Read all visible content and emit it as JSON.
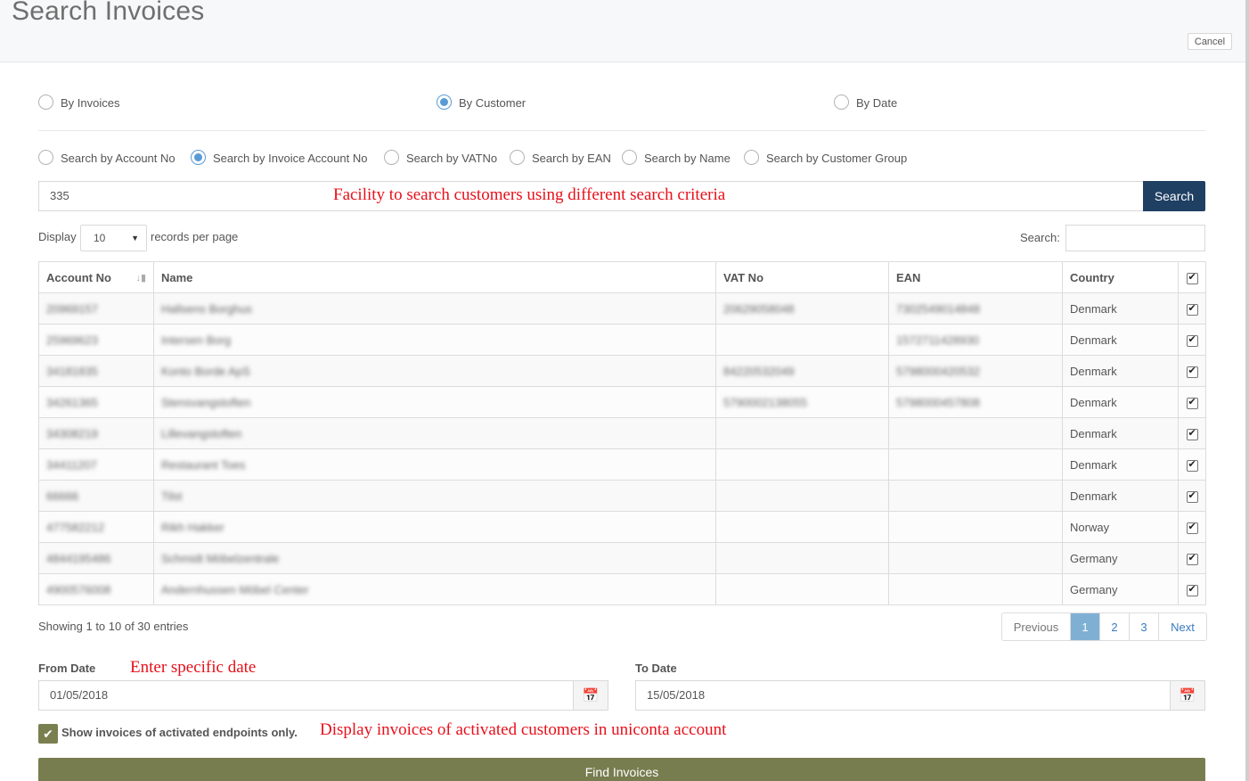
{
  "header": {
    "title": "Search Invoices",
    "cancel_label": "Cancel"
  },
  "mode_options": [
    {
      "label": "By Invoices",
      "checked": false
    },
    {
      "label": "By Customer",
      "checked": true
    },
    {
      "label": "By Date",
      "checked": false
    }
  ],
  "search_by_options": [
    {
      "label": "Search by Account No",
      "checked": false
    },
    {
      "label": "Search by Invoice Account No",
      "checked": true
    },
    {
      "label": "Search by VATNo",
      "checked": false
    },
    {
      "label": "Search by EAN",
      "checked": false
    },
    {
      "label": "Search by Name",
      "checked": false
    },
    {
      "label": "Search by Customer Group",
      "checked": false
    }
  ],
  "search": {
    "value": "335",
    "button_label": "Search"
  },
  "annotations": {
    "search_note": "Facility to search customers using different search criteria",
    "date_note": "Enter specific date",
    "activated_note": "Display invoices of activated customers in uniconta account"
  },
  "paging_controls": {
    "display_label": "Display",
    "page_size": "10",
    "records_label": "records per page",
    "filter_label": "Search:"
  },
  "table": {
    "columns": [
      "Account No",
      "Name",
      "VAT No",
      "EAN",
      "Country"
    ],
    "rows": [
      {
        "account": "20969157",
        "name": "Hallsens Borghus",
        "vat": "20629058048",
        "ean": "7302549014848",
        "country": "Denmark"
      },
      {
        "account": "25969623",
        "name": "Intersen Borg",
        "vat": "",
        "ean": "1572711428930",
        "country": "Denmark"
      },
      {
        "account": "34181835",
        "name": "Konto Borde ApS",
        "vat": "84220532049",
        "ean": "5798000420532",
        "country": "Denmark"
      },
      {
        "account": "34261365",
        "name": "Stensvangstoften",
        "vat": "5790002138055",
        "ean": "5798000457808",
        "country": "Denmark"
      },
      {
        "account": "34308219",
        "name": "Lillevangstoften",
        "vat": "",
        "ean": "",
        "country": "Denmark"
      },
      {
        "account": "34411207",
        "name": "Restaurant Toes",
        "vat": "",
        "ean": "",
        "country": "Denmark"
      },
      {
        "account": "66666",
        "name": "Tilst",
        "vat": "",
        "ean": "",
        "country": "Denmark"
      },
      {
        "account": "477582212",
        "name": "Rikh Hakker",
        "vat": "",
        "ean": "",
        "country": "Norway"
      },
      {
        "account": "4844195486",
        "name": "Schmidt Möbelzentrale",
        "vat": "",
        "ean": "",
        "country": "Germany"
      },
      {
        "account": "4900576008",
        "name": "Andernhussen Möbel Center",
        "vat": "",
        "ean": "",
        "country": "Germany"
      }
    ]
  },
  "pagination": {
    "info": "Showing 1 to 10 of 30 entries",
    "previous": "Previous",
    "pages": [
      "1",
      "2",
      "3"
    ],
    "active_page": "1",
    "next": "Next"
  },
  "dates": {
    "from_label": "From Date",
    "from_value": "01/05/2018",
    "to_label": "To Date",
    "to_value": "15/05/2018"
  },
  "activated": {
    "label": "Show invoices of activated endpoints only.",
    "checked": true
  },
  "find_button_label": "Find Invoices"
}
